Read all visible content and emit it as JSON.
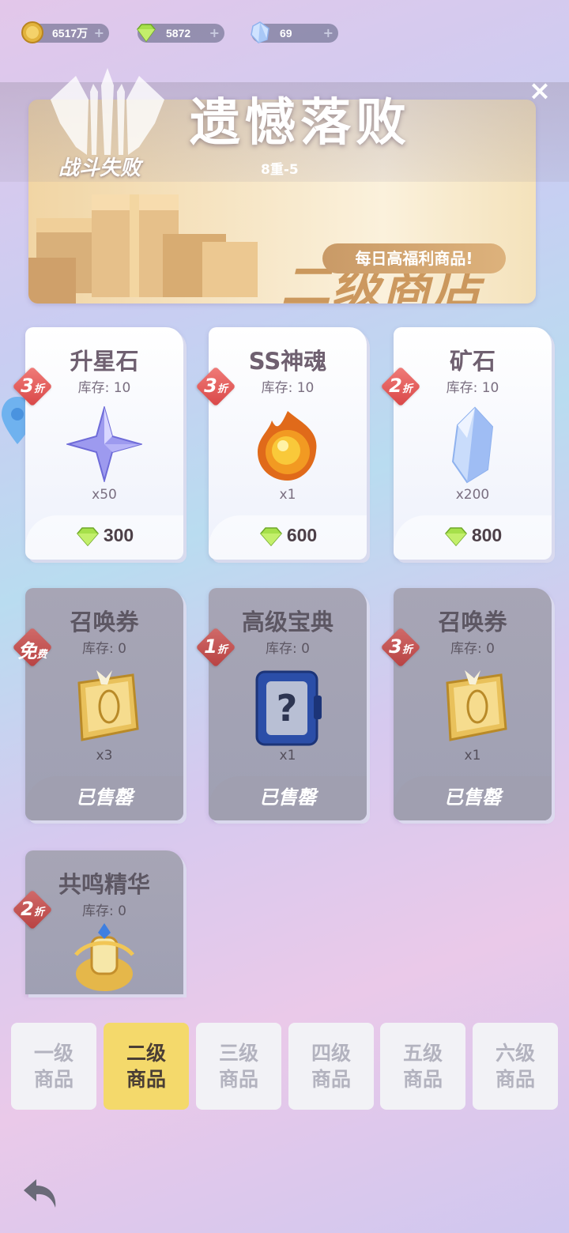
{
  "currencies": [
    {
      "icon": "gold-coin-icon",
      "value": "6517万",
      "plus": "+"
    },
    {
      "icon": "green-gem-icon",
      "value": "5872",
      "plus": "+"
    },
    {
      "icon": "blue-crystal-icon",
      "value": "69",
      "plus": "+"
    }
  ],
  "close_label": "×",
  "defeat": {
    "title": "遗憾落败",
    "subtitle": "8重-5",
    "emblem_text": "战斗失败"
  },
  "banner": {
    "shop_title": "二级商店",
    "tagline": "每日高福利商品!"
  },
  "items": [
    {
      "name": "升星石",
      "stock": "库存: 10",
      "qty": "x50",
      "price": "300",
      "discount": "3",
      "discount_unit": "折",
      "sold_out": false,
      "icon": "star-stone-icon"
    },
    {
      "name": "SS神魂",
      "stock": "库存: 10",
      "qty": "x1",
      "price": "600",
      "discount": "3",
      "discount_unit": "折",
      "sold_out": false,
      "icon": "fire-soul-icon"
    },
    {
      "name": "矿石",
      "stock": "库存: 10",
      "qty": "x200",
      "price": "800",
      "discount": "2",
      "discount_unit": "折",
      "sold_out": false,
      "icon": "ore-crystal-icon"
    },
    {
      "name": "召唤券",
      "stock": "库存: 0",
      "qty": "x3",
      "sold_label": "已售罄",
      "discount": "免",
      "discount_unit": "费",
      "sold_out": true,
      "icon": "summon-ticket-icon"
    },
    {
      "name": "高级宝典",
      "stock": "库存: 0",
      "qty": "x1",
      "sold_label": "已售罄",
      "discount": "1",
      "discount_unit": "折",
      "sold_out": true,
      "icon": "mystery-book-icon"
    },
    {
      "name": "召唤券",
      "stock": "库存: 0",
      "qty": "x1",
      "sold_label": "已售罄",
      "discount": "3",
      "discount_unit": "折",
      "sold_out": true,
      "icon": "summon-ticket-icon"
    },
    {
      "name": "共鸣精华",
      "stock": "库存: 0",
      "discount": "2",
      "discount_unit": "折",
      "sold_out": true,
      "icon": "resonance-essence-icon"
    }
  ],
  "tabs": [
    {
      "line1": "一级",
      "line2": "商品",
      "active": false
    },
    {
      "line1": "二级",
      "line2": "商品",
      "active": true
    },
    {
      "line1": "三级",
      "line2": "商品",
      "active": false
    },
    {
      "line1": "四级",
      "line2": "商品",
      "active": false
    },
    {
      "line1": "五级",
      "line2": "商品",
      "active": false
    },
    {
      "line1": "六级",
      "line2": "商品",
      "active": false
    }
  ],
  "colors": {
    "accent_tab": "#f4d96b",
    "badge_red": "#e05a58",
    "gem_green": "#a6e04a"
  }
}
